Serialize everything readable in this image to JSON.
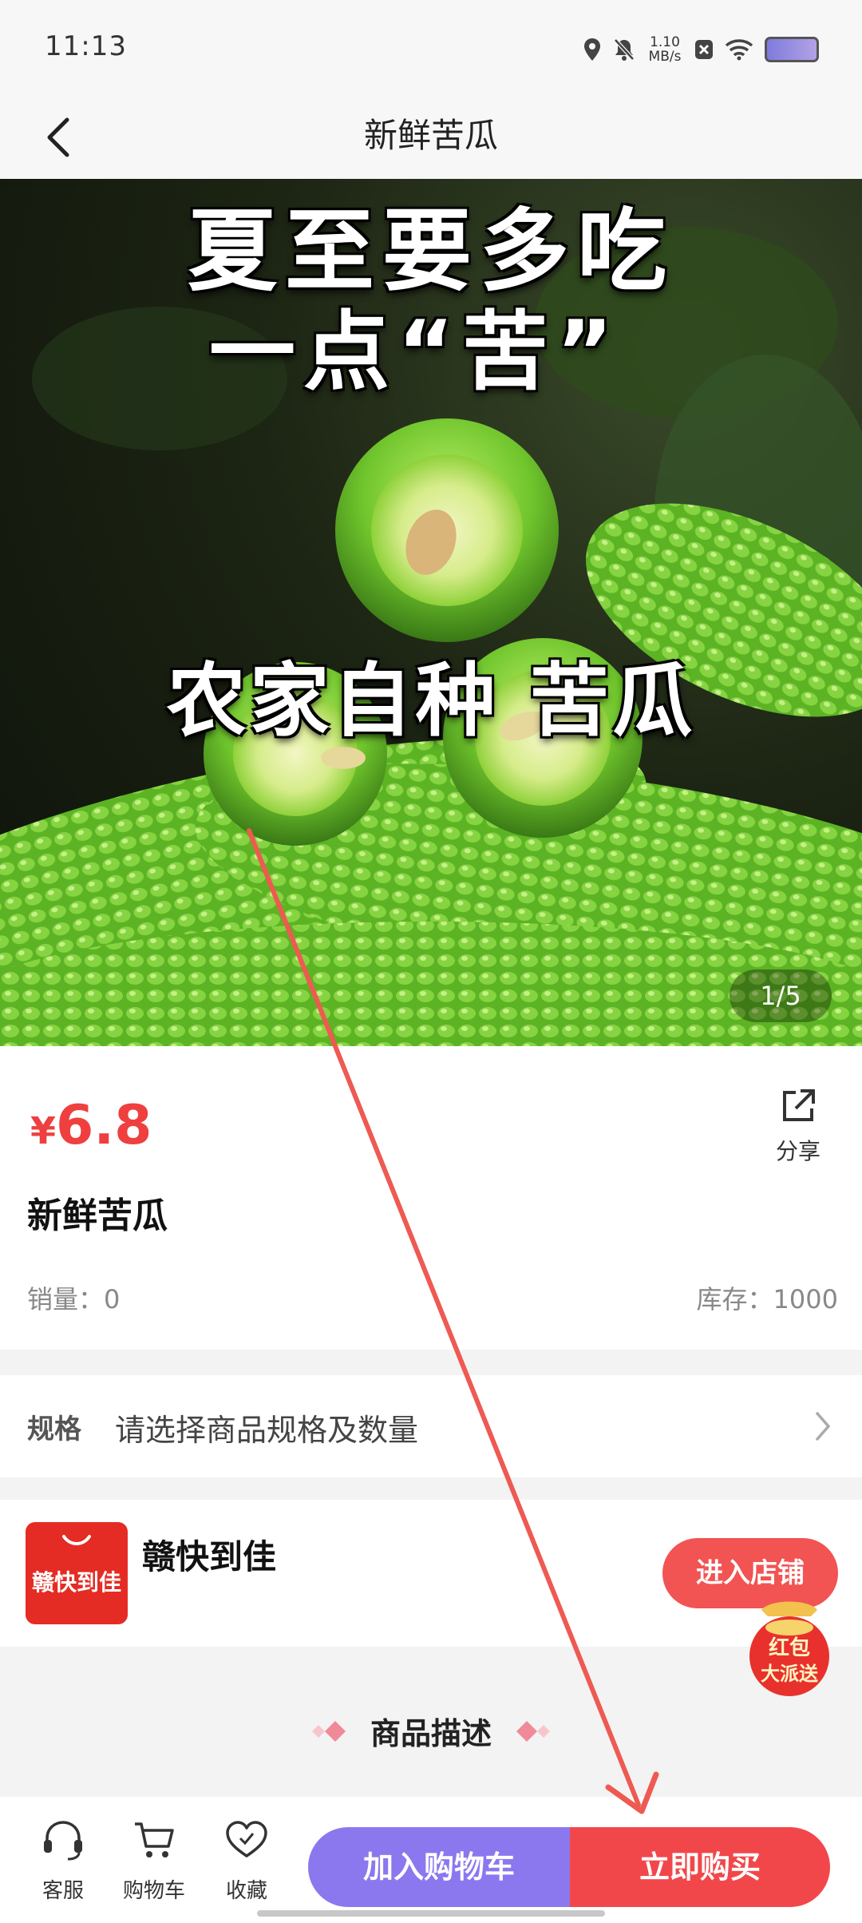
{
  "status_bar": {
    "time": "11:13",
    "net_speed_value": "1.10",
    "net_speed_unit": "MB/s",
    "icons": [
      "location-icon",
      "mute-icon",
      "close-box-icon",
      "wifi-icon",
      "battery-icon"
    ]
  },
  "title_bar": {
    "title": "新鲜苦瓜",
    "back_icon": "chevron-left-icon"
  },
  "hero": {
    "line1": "夏至要多吃",
    "line2": "一点“苦”",
    "line3": "农家自种 苦瓜",
    "counter": "1/5"
  },
  "product": {
    "currency": "¥",
    "price": "6.8",
    "name": "新鲜苦瓜",
    "share_label": "分享",
    "sales": "销量：0",
    "stock": "库存：1000"
  },
  "spec": {
    "label": "规格",
    "value": "请选择商品规格及数量"
  },
  "store": {
    "logo_text": "赣快到佳",
    "name": "赣快到佳",
    "enter_label": "进入店铺"
  },
  "red_packet": {
    "line1": "红包",
    "line2": "大派送"
  },
  "description": {
    "title": "商品描述"
  },
  "bottom_bar": {
    "service_label": "客服",
    "cart_label": "购物车",
    "favorite_label": "收藏",
    "add_to_cart_label": "加入购物车",
    "buy_now_label": "立即购买"
  },
  "colors": {
    "price": "#ef3f3f",
    "add_to_cart": "#8b78ef",
    "buy_now": "#f2474a",
    "store_logo": "#e42c24",
    "annotation_arrow": "#ee5a52"
  }
}
